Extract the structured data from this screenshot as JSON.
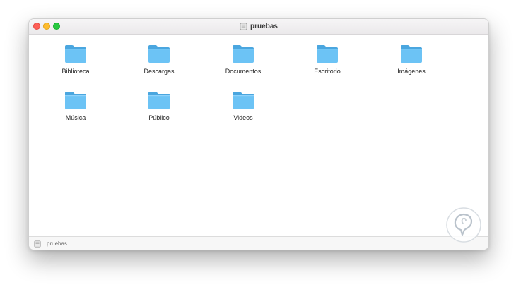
{
  "window": {
    "title": "pruebas",
    "title_icon": "drive-icon"
  },
  "traffic_lights": {
    "close_color": "#fd5f57",
    "minimize_color": "#febc2e",
    "maximize_color": "#28c840"
  },
  "folders": [
    {
      "label": "Biblioteca",
      "icon": "folder-icon"
    },
    {
      "label": "Descargas",
      "icon": "folder-icon"
    },
    {
      "label": "Documentos",
      "icon": "folder-icon"
    },
    {
      "label": "Escritorio",
      "icon": "folder-icon"
    },
    {
      "label": "Imágenes",
      "icon": "folder-icon"
    },
    {
      "label": "Música",
      "icon": "folder-icon"
    },
    {
      "label": "Público",
      "icon": "folder-icon"
    },
    {
      "label": "Videos",
      "icon": "folder-icon"
    }
  ],
  "status_bar": {
    "path_label": "pruebas",
    "path_icon": "drive-icon"
  },
  "colors": {
    "folder_blue": "#6cc3f5",
    "folder_tab": "#4aa6df"
  }
}
